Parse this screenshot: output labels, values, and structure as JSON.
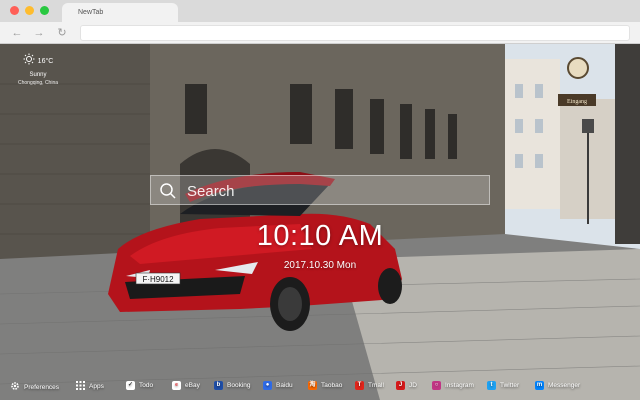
{
  "browser": {
    "tab_title": "NewTab",
    "traffic_lights": [
      "#ff5f57",
      "#febc2e",
      "#28c840"
    ]
  },
  "weather": {
    "temperature": "16°C",
    "condition": "Sunny",
    "location": "Chongqing, China",
    "icon": "sun-icon"
  },
  "search": {
    "placeholder": "Search"
  },
  "clock": {
    "time": "10:10 AM",
    "date": "2017.10.30 Mon"
  },
  "bottom_bar": {
    "items": [
      {
        "label": "Preferences",
        "icon": "gear-icon",
        "color": "#ffffff"
      },
      {
        "label": "Apps",
        "icon": "apps-grid-icon",
        "color": "#ffffff"
      },
      {
        "label": "Todo",
        "icon": "checkbox-icon",
        "color": "#ffffff"
      },
      {
        "label": "eBay",
        "icon": "ebay-icon",
        "color": "#ffffff"
      },
      {
        "label": "Booking",
        "icon": "booking-icon",
        "color": "#1e4ea8"
      },
      {
        "label": "Baidu",
        "icon": "baidu-icon",
        "color": "#2f6be6"
      },
      {
        "label": "Taobao",
        "icon": "taobao-icon",
        "color": "#ff6a00"
      },
      {
        "label": "Tmall",
        "icon": "tmall-icon",
        "color": "#e1251b"
      },
      {
        "label": "JD",
        "icon": "jd-icon",
        "color": "#d7191a"
      },
      {
        "label": "Instagram",
        "icon": "instagram-icon",
        "color": "#c13584"
      },
      {
        "label": "Twitter",
        "icon": "twitter-icon",
        "color": "#1da1f2"
      },
      {
        "label": "Messenger",
        "icon": "messenger-icon",
        "color": "#0084ff"
      }
    ]
  },
  "background": {
    "car_plate": "F·H9012",
    "shop_sign": "Eingang"
  }
}
